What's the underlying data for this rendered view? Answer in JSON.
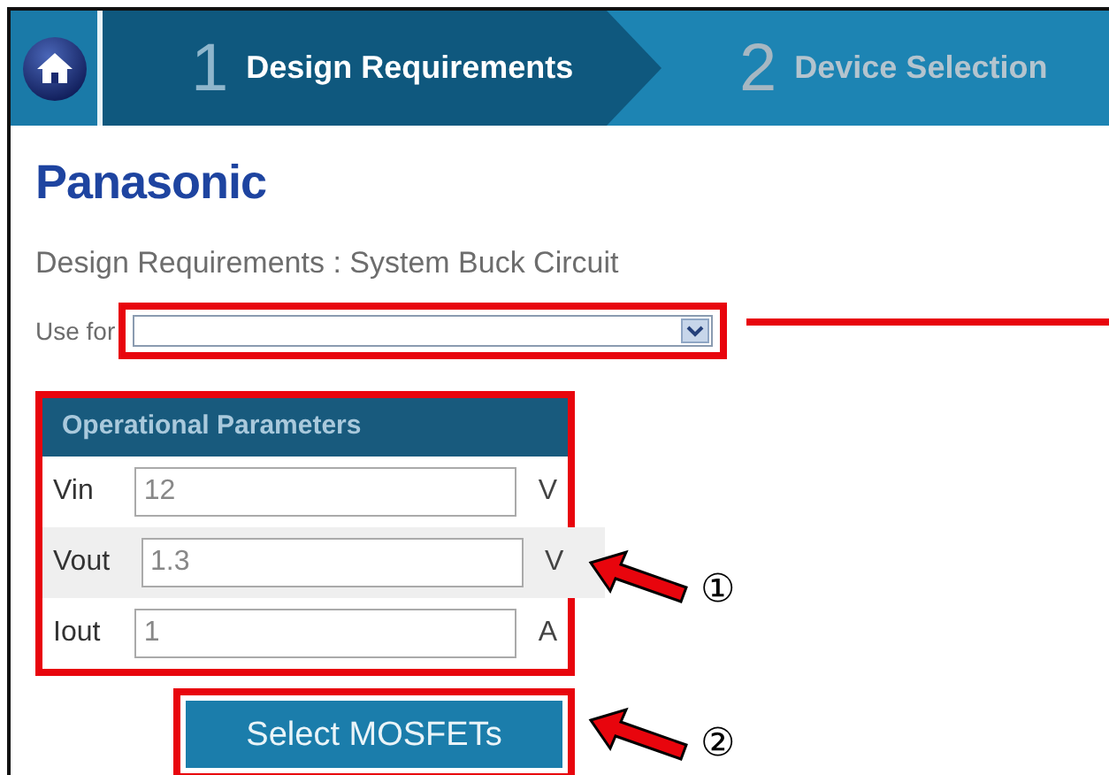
{
  "header": {
    "steps": [
      {
        "number": "1",
        "label": "Design Requirements",
        "selected": true
      },
      {
        "number": "2",
        "label": "Device Selection",
        "selected": false
      }
    ]
  },
  "logo": "Panasonic",
  "subtitle": "Design Requirements : System Buck Circuit",
  "use_for": {
    "label": "Use for"
  },
  "panel": {
    "title": "Operational Parameters",
    "rows": [
      {
        "label": "Vin",
        "value": "12",
        "unit": "V",
        "highlighted": false
      },
      {
        "label": "Vout",
        "value": "1.3",
        "unit": "V",
        "highlighted": true
      },
      {
        "label": "Iout",
        "value": "1",
        "unit": "A",
        "highlighted": false
      }
    ]
  },
  "button": "Select MOSFETs",
  "callouts": [
    "①",
    "②"
  ]
}
